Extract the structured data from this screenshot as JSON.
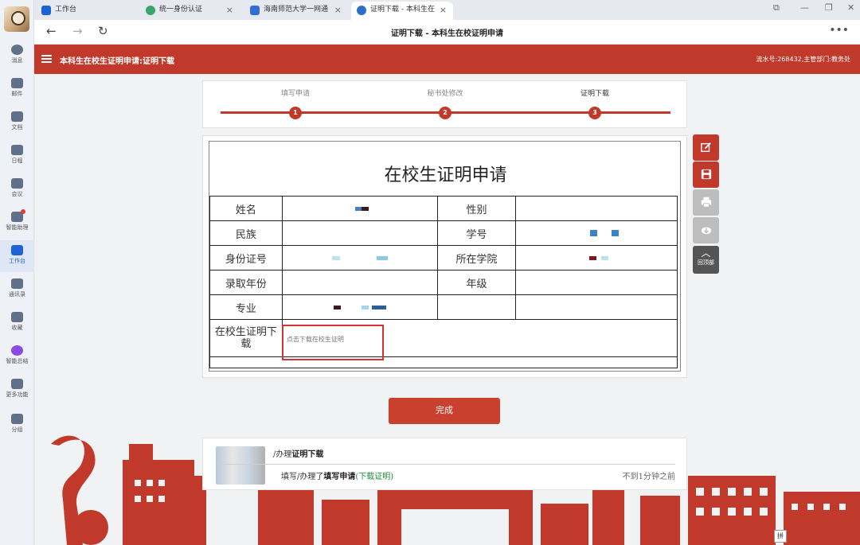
{
  "dock": {
    "items": [
      {
        "label": "消息"
      },
      {
        "label": "邮件"
      },
      {
        "label": "文档"
      },
      {
        "label": "日程"
      },
      {
        "label": "会议"
      },
      {
        "label": "智能助理"
      },
      {
        "label": "工作台"
      },
      {
        "label": "通讯录"
      },
      {
        "label": "收藏"
      },
      {
        "label": "智能总结"
      },
      {
        "label": "更多功能"
      },
      {
        "label": "分组"
      }
    ],
    "active_index": 6
  },
  "tabs": [
    {
      "label": "工作台"
    },
    {
      "label": "统一身份认证"
    },
    {
      "label": "海南师范大学一网通"
    },
    {
      "label": "证明下载 - 本科生在"
    }
  ],
  "address_bar": {
    "title": "证明下载 - 本科生在校证明申请"
  },
  "header": {
    "title": "本科生在校生证明申请:证明下载",
    "right_info": "流水号:268432,主管部门:教务处"
  },
  "steps": [
    {
      "label": "填写申请",
      "number": "1"
    },
    {
      "label": "秘书处修改",
      "number": "2"
    },
    {
      "label": "证明下载",
      "number": "3"
    }
  ],
  "form": {
    "title": "在校生证明申请",
    "rows": [
      {
        "label1": "姓名",
        "label2": "性别"
      },
      {
        "label1": "民族",
        "label2": "学号"
      },
      {
        "label1": "身份证号",
        "label2": "所在学院"
      },
      {
        "label1": "录取年份",
        "label2": "年级"
      },
      {
        "label1": "专业",
        "label2": ""
      }
    ],
    "download_label": "在校生证明下载",
    "download_link": "点击下载在校生证明"
  },
  "side_tools": {
    "back_to_top": "回顶部"
  },
  "finish_button": "完成",
  "activity": {
    "row1_prefix": "/办理",
    "row1_action": "证明下载",
    "row2_prefix": "填写/办理了",
    "row2_action": "填写申请",
    "row2_extra": "(下载证明)",
    "time": "不到1分钟之前"
  },
  "ime": "拼",
  "colors": {
    "accent": "#c0392b",
    "active_blue": "#1e63d6"
  }
}
